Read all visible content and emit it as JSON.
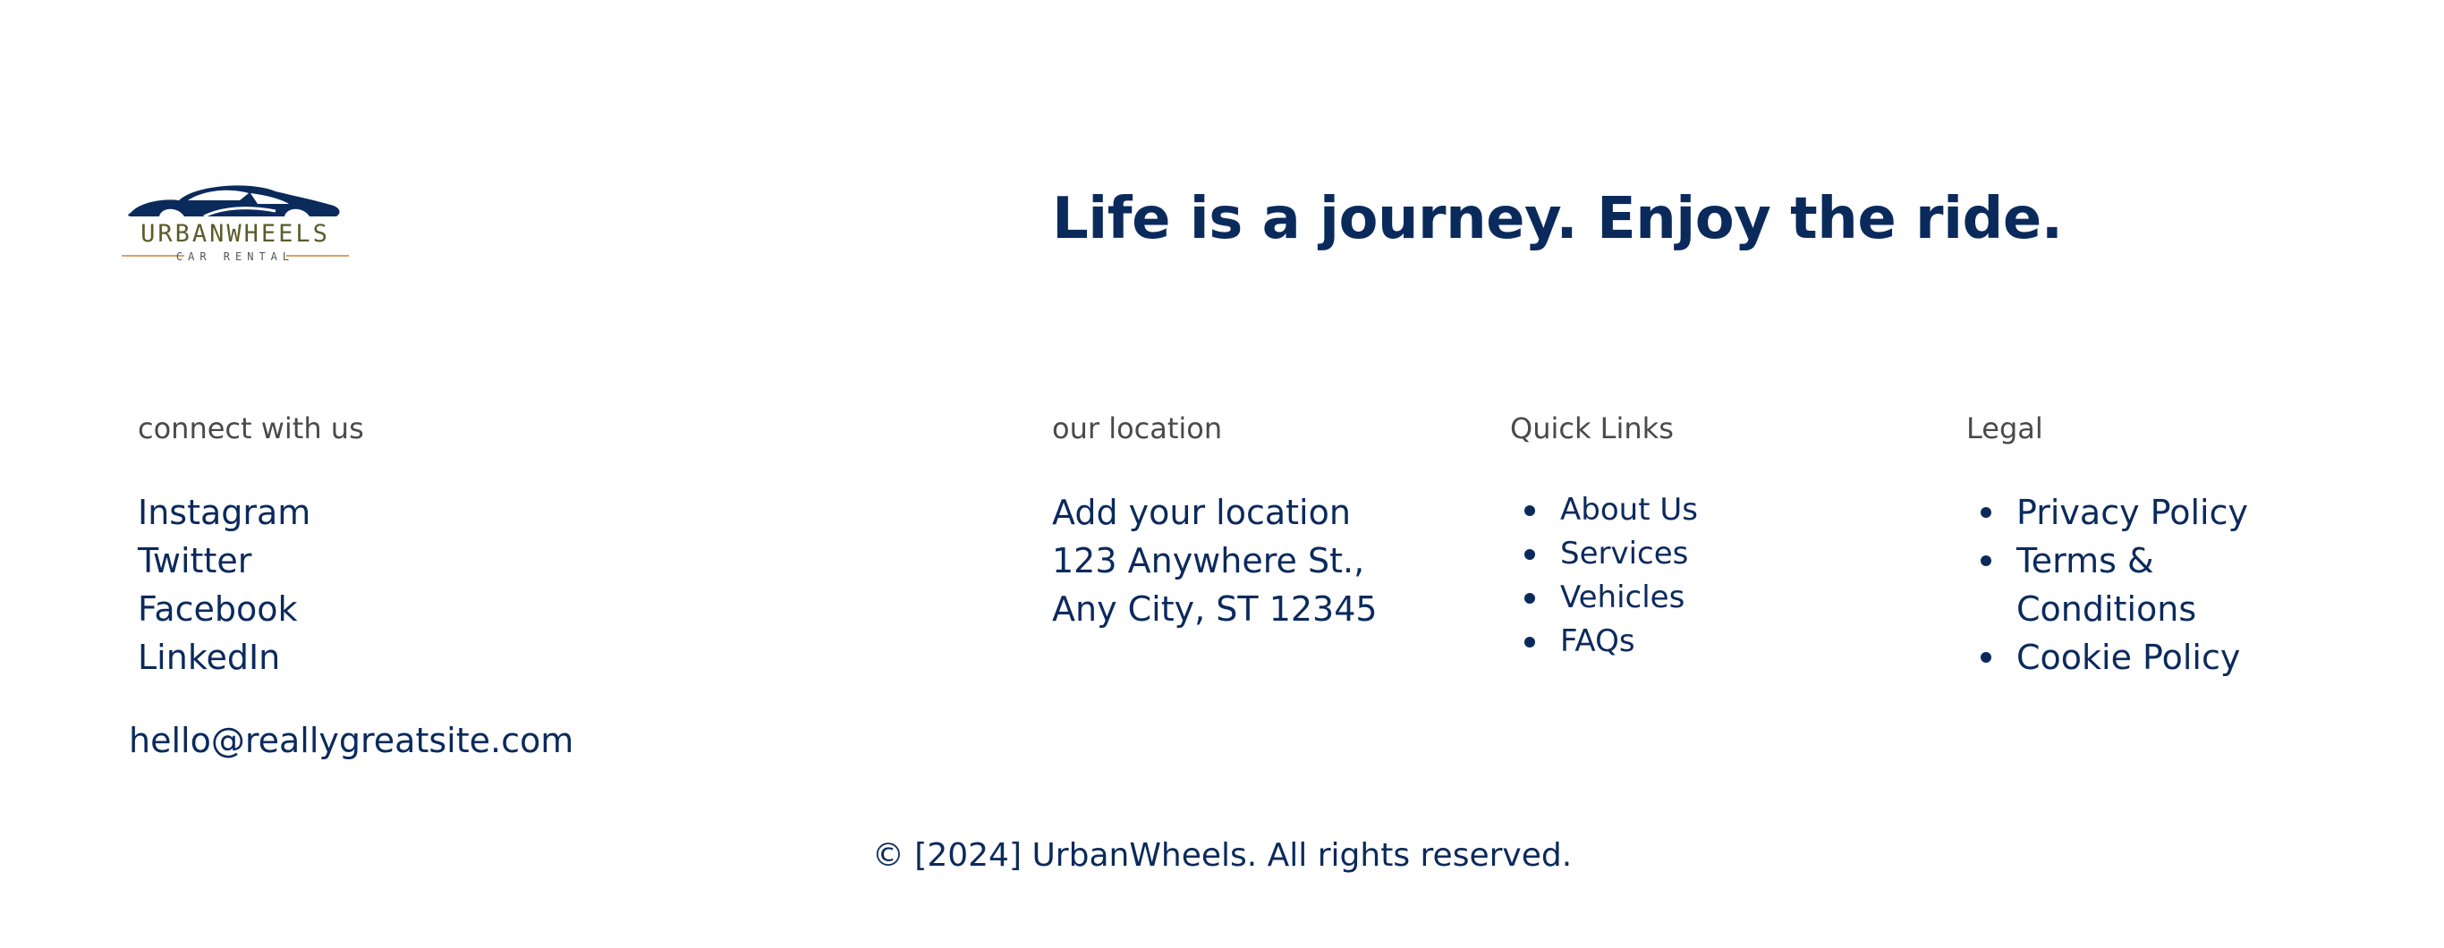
{
  "brand": {
    "logo_name": "URBANWHEELS",
    "logo_sub": "CAR RENTAL",
    "colors": {
      "navy": "#0b2a5c",
      "olive": "#5b5b2a",
      "orange": "#d9a25f",
      "muted_text": "#4a4a4a"
    }
  },
  "tagline": "Life is a journey. Enjoy the ride.",
  "connect": {
    "heading": "connect with us",
    "links": [
      "Instagram",
      "Twitter",
      "Facebook",
      "LinkedIn"
    ],
    "email": "hello@reallygreatsite.com"
  },
  "location": {
    "heading": "our location",
    "lines": [
      "Add your location",
      "123 Anywhere St.,",
      "Any City, ST 12345"
    ]
  },
  "quick_links": {
    "heading": "Quick Links",
    "items": [
      "About Us",
      "Services",
      "Vehicles",
      "FAQs"
    ]
  },
  "legal": {
    "heading": "Legal",
    "items": [
      "Privacy Policy",
      "Terms & Conditions",
      "Cookie Policy"
    ]
  },
  "footer": {
    "copyright": "© [2024] UrbanWheels. All rights reserved."
  }
}
